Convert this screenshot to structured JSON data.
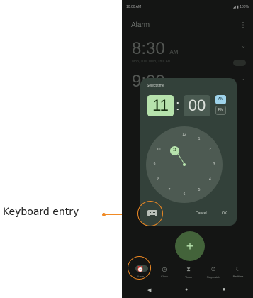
{
  "callout": {
    "label": "Keyboard entry",
    "color": "#f08a24"
  },
  "status_bar": {
    "time": "10:00 AM",
    "battery": "100%"
  },
  "app": {
    "title": "Alarm"
  },
  "alarms": [
    {
      "time": "8:30",
      "period": "AM",
      "days": "Mon, Tue, Wed, Thu, Fri"
    },
    {
      "time": "9:00"
    }
  ],
  "dialog": {
    "label": "Select time",
    "hour": "11",
    "colon": ":",
    "minute": "00",
    "am": "AM",
    "pm": "PM",
    "selected_period": "AM",
    "clock_numbers": [
      "12",
      "1",
      "2",
      "3",
      "4",
      "5",
      "6",
      "7",
      "8",
      "9",
      "10",
      "11"
    ],
    "selected_hour": "11",
    "cancel": "Cancel",
    "ok": "OK",
    "keyboard_icon": "keyboard-icon"
  },
  "fab": {
    "icon": "add-icon",
    "glyph": "+"
  },
  "bottom_nav": [
    {
      "label": "Alarm",
      "glyph": "⏰",
      "icon": "alarm-icon"
    },
    {
      "label": "Clock",
      "glyph": "◷",
      "icon": "clock-icon"
    },
    {
      "label": "Timer",
      "glyph": "⧗",
      "icon": "timer-icon"
    },
    {
      "label": "Stopwatch",
      "glyph": "⏱",
      "icon": "stopwatch-icon"
    },
    {
      "label": "Bedtime",
      "glyph": "☾",
      "icon": "bedtime-icon"
    }
  ],
  "system_nav": {
    "back": "◀",
    "home": "●",
    "recents": "■"
  },
  "colors": {
    "accent": "#b6e2ac",
    "dialog_bg": "#33413a",
    "highlight": "#f08a24"
  }
}
